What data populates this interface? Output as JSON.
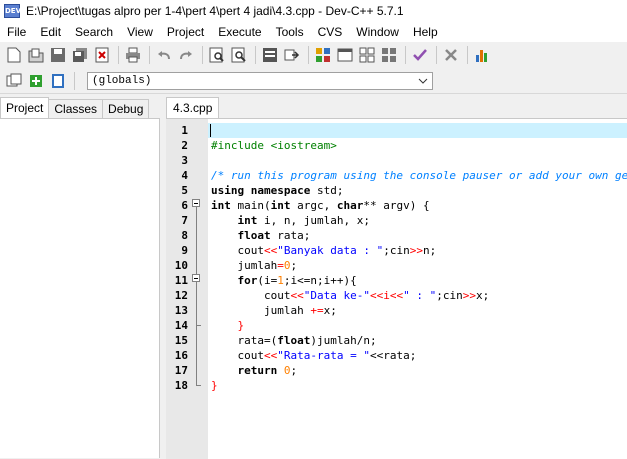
{
  "window": {
    "title": "E:\\Project\\tugas alpro per 1-4\\pert 4\\pert 4 jadi\\4.3.cpp - Dev-C++ 5.7.1",
    "app_icon": "DEV"
  },
  "menu": [
    "File",
    "Edit",
    "Search",
    "View",
    "Project",
    "Execute",
    "Tools",
    "CVS",
    "Window",
    "Help"
  ],
  "toolbar": {
    "scope_value": "(globals)"
  },
  "left_tabs": [
    "Project",
    "Classes",
    "Debug"
  ],
  "editor_tab": "4.3.cpp",
  "lines": [
    {
      "n": "1"
    },
    {
      "n": "2"
    },
    {
      "n": "3"
    },
    {
      "n": "4"
    },
    {
      "n": "5"
    },
    {
      "n": "6"
    },
    {
      "n": "7"
    },
    {
      "n": "8"
    },
    {
      "n": "9"
    },
    {
      "n": "10"
    },
    {
      "n": "11"
    },
    {
      "n": "12"
    },
    {
      "n": "13"
    },
    {
      "n": "14"
    },
    {
      "n": "15"
    },
    {
      "n": "16"
    },
    {
      "n": "17"
    },
    {
      "n": "18"
    }
  ],
  "code": {
    "l2": "#include <iostream>",
    "l4": "/* run this program using the console pauser or add your own getch, system(\"pause\") or input loop */",
    "l5a": "using namespace",
    "l5b": " std;",
    "l6a": "int",
    "l6b": " main(",
    "l6c": "int",
    "l6d": " argc, ",
    "l6e": "char",
    "l6f": "** argv) {",
    "l7a": "    int",
    "l7b": " i, n, jumlah, x;",
    "l8a": "    float",
    "l8b": " rata;",
    "l9a": "    cout",
    "l9b": "<<",
    "l9c": "\"Banyak data : \"",
    "l9d": ";cin",
    "l9e": ">>",
    "l9f": "n;",
    "l10a": "    jumlah",
    "l10b": "=",
    "l10c": "0",
    "l10d": ";",
    "l11a": "    for",
    "l11b": "(i=",
    "l11c": "1",
    "l11d": ";i<=n;i++){",
    "l12a": "        cout",
    "l12b": "<<",
    "l12c": "\"Data ke-\"",
    "l12d": "<<i<<",
    "l12e": "\" : \"",
    "l12f": ";cin",
    "l12g": ">>",
    "l12h": "x;",
    "l13a": "        jumlah ",
    "l13b": "+=",
    "l13c": "x;",
    "l14": "    }",
    "l15a": "    rata=(",
    "l15b": "float",
    "l15c": ")jumlah/n;",
    "l16a": "    cout",
    "l16b": "<<",
    "l16c": "\"Rata-rata = \"",
    "l16d": "<<rata;",
    "l17a": "    return",
    "l17b": " ",
    "l17c": "0",
    "l17d": ";",
    "l18": "}"
  }
}
